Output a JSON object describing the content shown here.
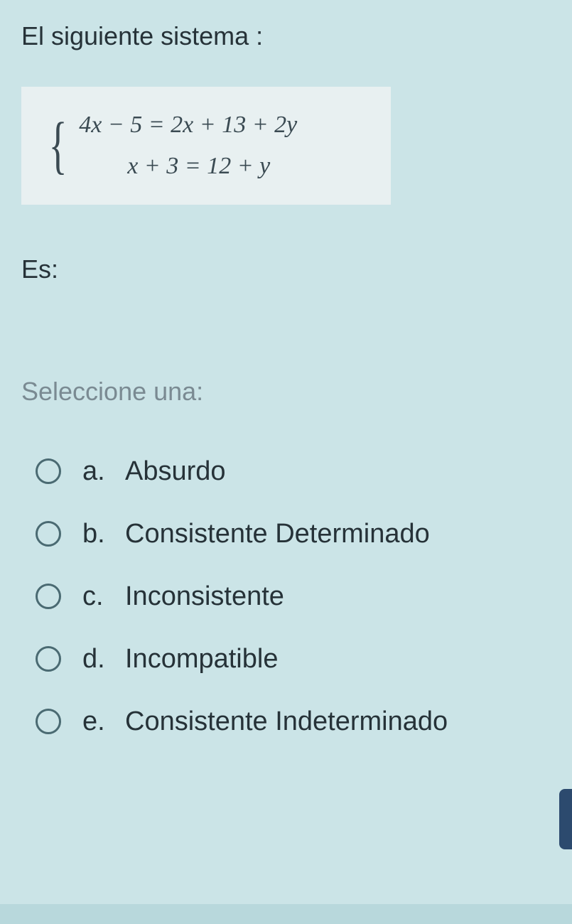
{
  "question": {
    "intro": "El siguiente sistema :",
    "equation1": "4x − 5 = 2x + 13 + 2y",
    "equation2": "x + 3 = 12 + y",
    "es_label": "Es:",
    "select_label": "Seleccione una:"
  },
  "options": [
    {
      "letter": "a.",
      "text": "Absurdo"
    },
    {
      "letter": "b.",
      "text": "Consistente Determinado"
    },
    {
      "letter": "c.",
      "text": "Inconsistente"
    },
    {
      "letter": "d.",
      "text": "Incompatible"
    },
    {
      "letter": "e.",
      "text": "Consistente Indeterminado"
    }
  ]
}
